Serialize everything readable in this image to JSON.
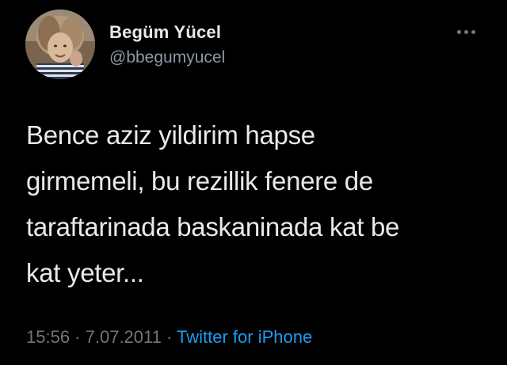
{
  "user": {
    "display_name": "Begüm Yücel",
    "handle": "@bbegumyucel",
    "avatar_icon": "avatar-photo"
  },
  "tweet": {
    "text": "Bence aziz yildirim hapse\ngirmemeli, bu rezillik fenere de\ntaraftarinada baskaninada kat be\nkat yeter...",
    "time": "15:56",
    "separator": " · ",
    "date": "7.07.2011",
    "source": "Twitter for iPhone"
  },
  "menu": {
    "more_icon": "more-horizontal-icon"
  },
  "colors": {
    "background": "#000000",
    "text": "#e7e9ea",
    "secondary": "#71767b",
    "link": "#1d9bf0"
  }
}
